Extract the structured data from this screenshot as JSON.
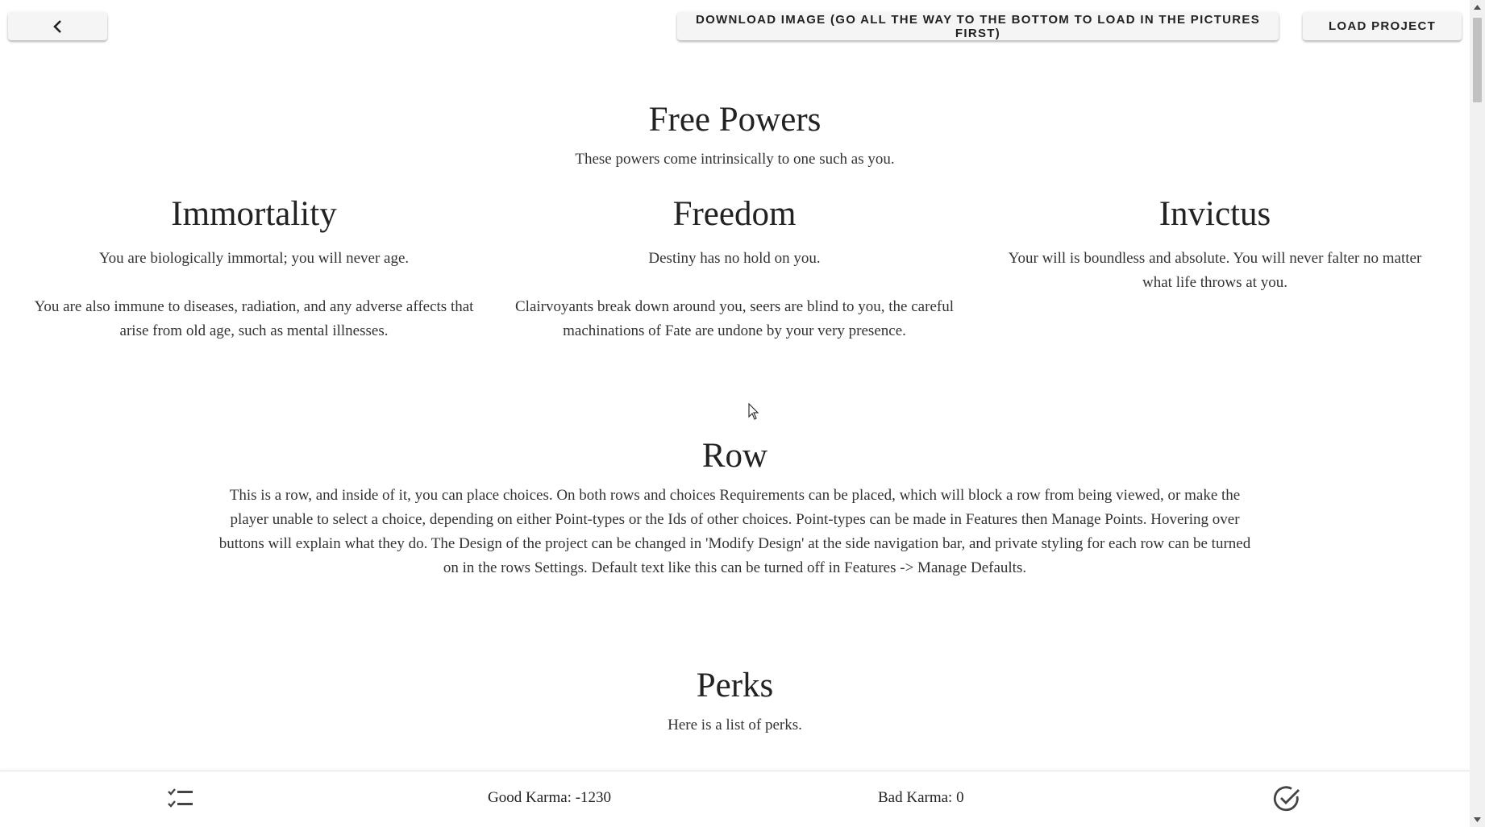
{
  "toolbar": {
    "back_icon": "chevron-left-icon",
    "download_label": "DOWNLOAD IMAGE (GO ALL THE WAY TO THE BOTTOM TO LOAD IN THE PICTURES FIRST)",
    "load_label": "LOAD PROJECT"
  },
  "free_powers": {
    "title": "Free Powers",
    "description": "These powers come intrinsically to one such as you.",
    "choices": [
      {
        "title": "Immortality",
        "paragraphs": [
          "You are biologically immortal; you will never age.",
          "You are also immune to diseases, radiation, and any adverse affects that arise from old age, such as mental illnesses."
        ]
      },
      {
        "title": "Freedom",
        "paragraphs": [
          "Destiny has no hold on you.",
          "Clairvoyants break down around you, seers are blind to you, the careful machinations of Fate are undone by your very presence."
        ]
      },
      {
        "title": "Invictus",
        "paragraphs": [
          "Your will is boundless and absolute. You will never falter no matter what life throws at you."
        ]
      }
    ]
  },
  "row": {
    "title": "Row",
    "description": "This is a row, and inside of it, you can place choices. On both rows and choices Requirements can be placed, which will block a row from being viewed, or make the player unable to select a choice, depending on either Point-types or the Ids of other choices. Point-types can be made in Features then Manage Points. Hovering over buttons will explain what they do. The Design of the project can be changed in 'Modify Design' at the side navigation bar, and private styling for each row can be turned on in the rows Settings. Default text like this can be turned off in Features -> Manage Defaults."
  },
  "perks": {
    "title": "Perks",
    "description": "Here is a list of perks."
  },
  "bottom_bar": {
    "left_icon": "checklist-icon",
    "good_karma": "Good Karma: -1230",
    "bad_karma": "Bad Karma: 0",
    "right_icon": "check-circle-icon"
  }
}
